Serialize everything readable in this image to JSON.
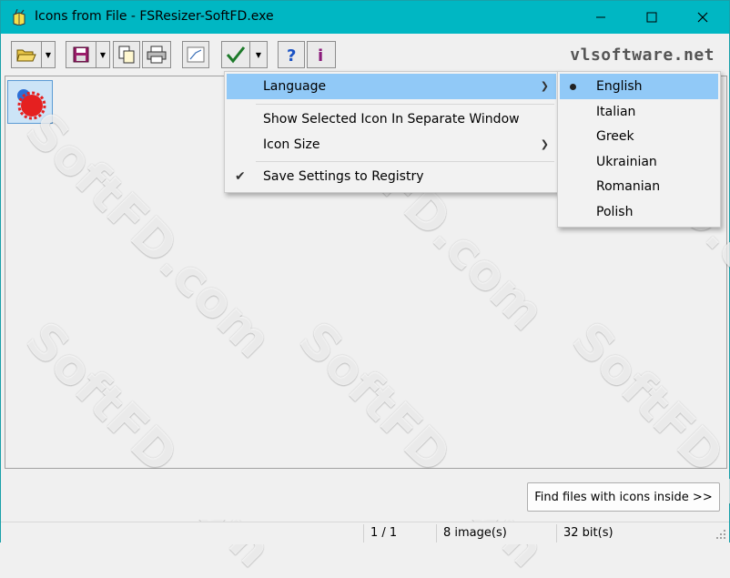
{
  "window": {
    "title": "Icons from File - FSResizer-SoftFD.exe"
  },
  "toolbar": {
    "brand": "vlsoftware.net"
  },
  "watermark": {
    "text": "SoftFD.com"
  },
  "context_menu": {
    "items": [
      {
        "label": "Language",
        "has_submenu": true,
        "highlighted": true
      },
      {
        "label": "Show Selected Icon In Separate Window"
      },
      {
        "label": "Icon Size",
        "has_submenu": true
      },
      {
        "label": "Save Settings to Registry",
        "checked": true
      }
    ]
  },
  "language_menu": {
    "items": [
      {
        "label": "English",
        "selected": true
      },
      {
        "label": "Italian"
      },
      {
        "label": "Greek"
      },
      {
        "label": "Ukrainian"
      },
      {
        "label": "Romanian"
      },
      {
        "label": "Polish"
      }
    ]
  },
  "buttons": {
    "find_files": "Find files with icons inside >>"
  },
  "status": {
    "page": "1 / 1",
    "images": "8 image(s)",
    "bits": "32 bit(s)"
  },
  "colors": {
    "titlebar": "#00b7c3",
    "menu_highlight": "#91c9f7",
    "selection_border": "#5b9bd5"
  }
}
